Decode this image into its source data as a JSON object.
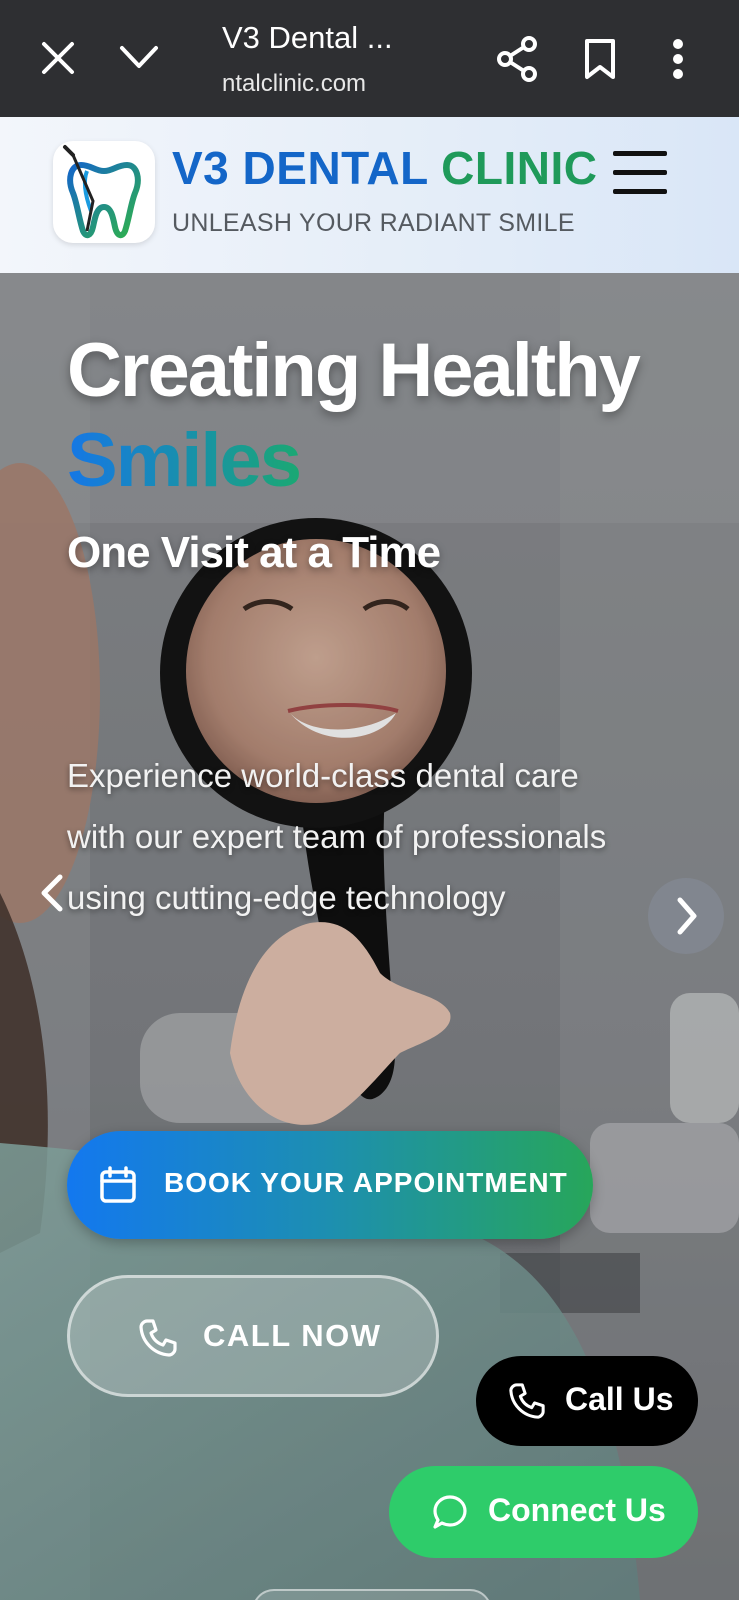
{
  "browser": {
    "title": "V3 Dental ...",
    "url": "ntalclinic.com"
  },
  "header": {
    "brand_part1": "V3 DENTAL",
    "brand_part2": "CLINIC",
    "tagline": "UNLEASH YOUR RADIANT SMILE"
  },
  "hero": {
    "title": "Creating Healthy",
    "accent": "Smiles",
    "subtitle": "One Visit at a Time",
    "description": "Experience world-class dental care with our expert team of professionals using cutting-edge technology"
  },
  "buttons": {
    "book": "BOOK YOUR APPOINTMENT",
    "call_now": "CALL NOW",
    "call_us": "Call Us",
    "connect": "Connect Us"
  },
  "icons": {
    "close": "close-icon",
    "collapse": "chevron-down-icon",
    "share": "share-icon",
    "bookmark": "bookmark-icon",
    "more": "more-vert-icon",
    "menu": "hamburger-icon",
    "calendar": "calendar-icon",
    "phone": "phone-icon",
    "whatsapp": "chat-bubble-icon",
    "prev": "chevron-left-icon",
    "next": "chevron-right-icon"
  },
  "colors": {
    "brand_blue": "#1466c8",
    "brand_green": "#1f9a5a",
    "book_gradient_start": "#1378ef",
    "book_gradient_end": "#27a65a",
    "connect_green": "#2ecc6a",
    "browser_bar": "#2e2f32"
  }
}
